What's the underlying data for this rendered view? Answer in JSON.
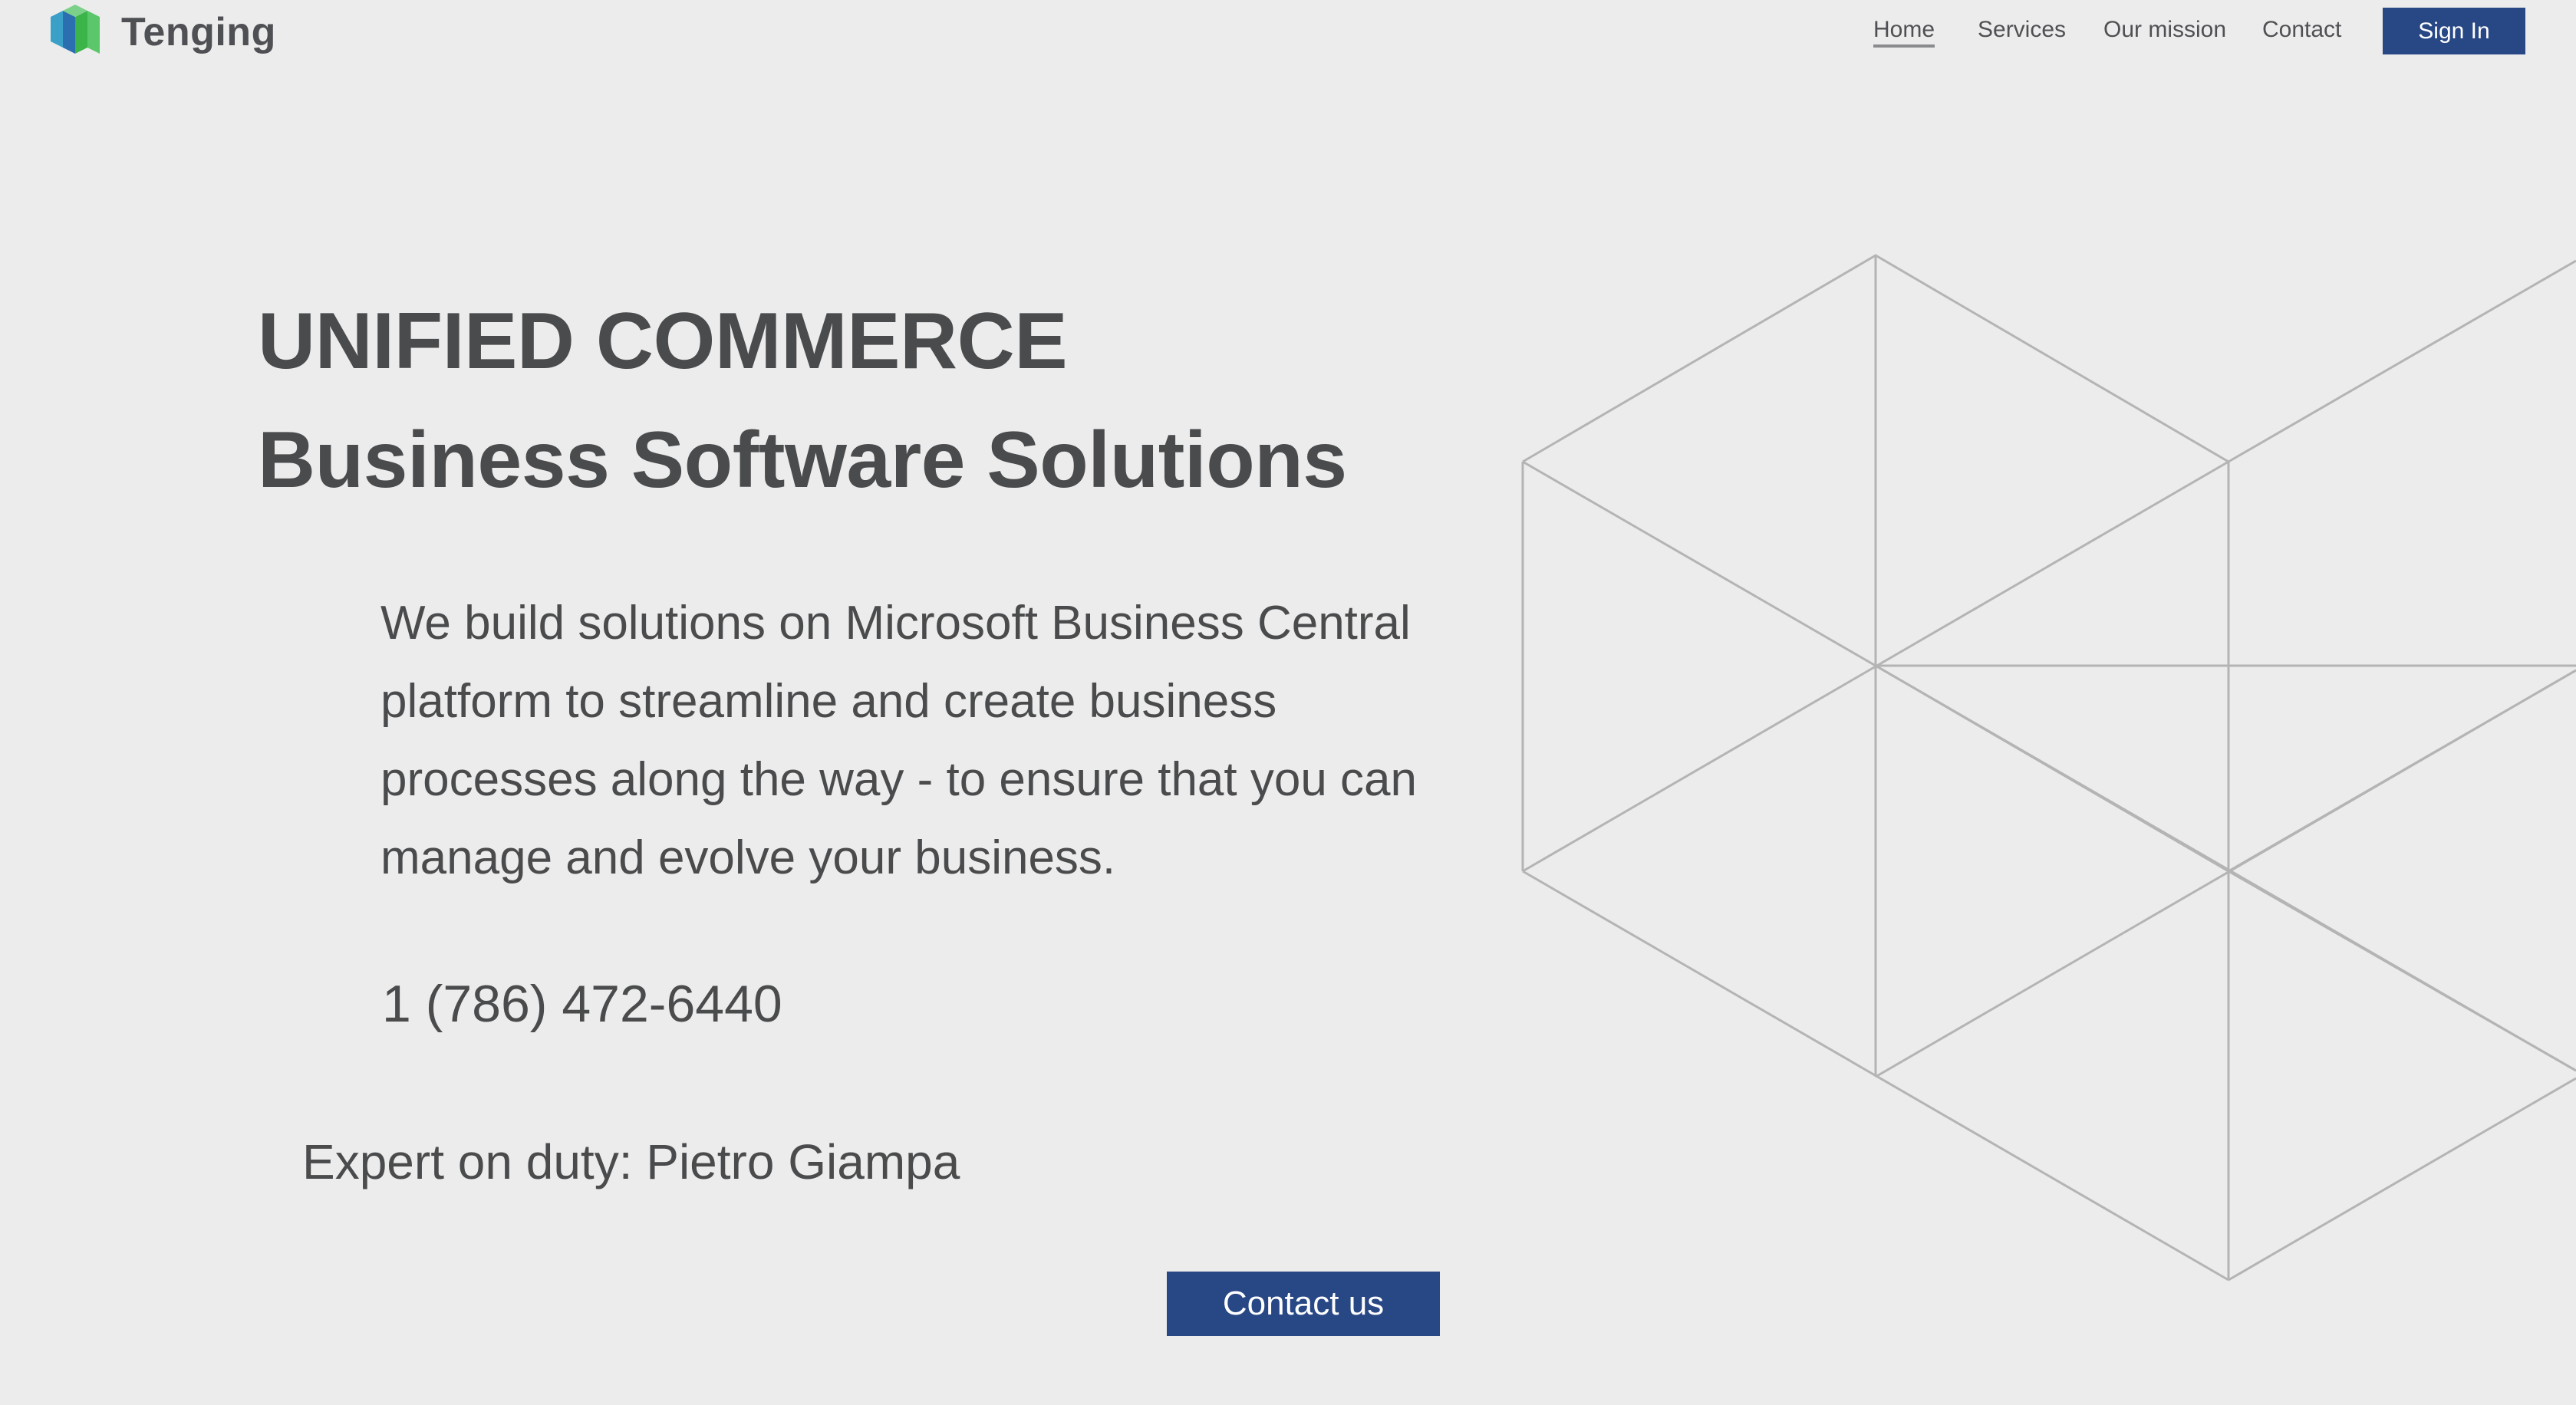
{
  "brand": {
    "name": "Tenging",
    "logo_icon": "tenging-cube-logo-icon"
  },
  "nav": {
    "items": [
      {
        "label": "Home",
        "active": true
      },
      {
        "label": "Services",
        "active": false
      },
      {
        "label": "Our mission",
        "active": false
      },
      {
        "label": "Contact",
        "active": false
      }
    ],
    "signin_label": "Sign In"
  },
  "hero": {
    "title_line1": "UNIFIED COMMERCE",
    "title_line2": "Business Software Solutions",
    "description": "We build solutions on Microsoft Business Central platform to streamline and create business processes along the way - to ensure that you can manage and evolve your business.",
    "phone": "1 (786) 472-6440",
    "expert": "Expert on duty: Pietro Giampa",
    "contact_label": "Contact us"
  },
  "colors": {
    "background": "#ececec",
    "primary": "#274785",
    "text": "#4a4b4d",
    "decor_lines": "#b4b4b4"
  }
}
